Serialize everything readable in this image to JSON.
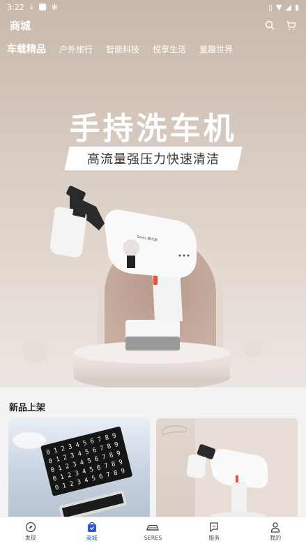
{
  "status": {
    "time": "3:22"
  },
  "header": {
    "title": "商城"
  },
  "categories": [
    {
      "label": "车载精品",
      "active": true
    },
    {
      "label": "户外旅行"
    },
    {
      "label": "智能科技"
    },
    {
      "label": "悦享生活"
    },
    {
      "label": "童趣世界"
    }
  ],
  "banner": {
    "headline": "手持洗车机",
    "subheadline": "高流量强压力快速清洁",
    "product_brand": "Seres 赛力斯"
  },
  "section": {
    "title": "新品上架"
  },
  "keypad_rows": [
    "0123456789",
    "0123456789",
    "0123456789",
    "0123456789",
    "0123456789"
  ],
  "tabs": [
    {
      "label": "发现",
      "icon": "compass-icon"
    },
    {
      "label": "商城",
      "icon": "bag-icon",
      "active": true
    },
    {
      "label": "SERES",
      "icon": "car-icon"
    },
    {
      "label": "服务",
      "icon": "flag-icon"
    },
    {
      "label": "我的",
      "icon": "person-icon"
    }
  ],
  "colors": {
    "accent": "#2d5ad8",
    "hero_bg": "#d8cbc1"
  }
}
